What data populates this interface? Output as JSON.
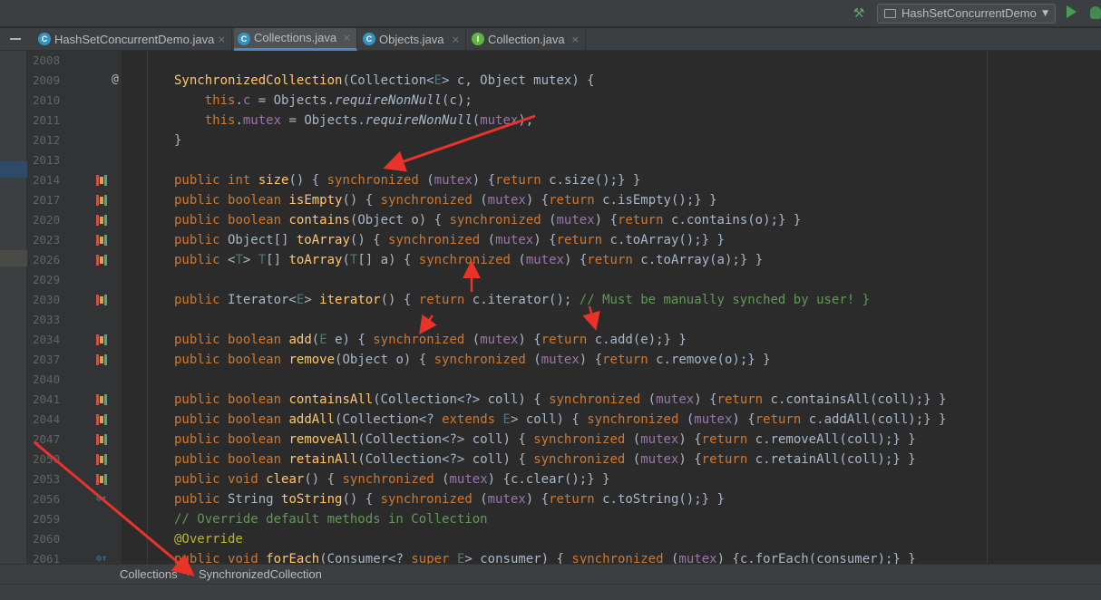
{
  "toolbar": {
    "run_config": "HashSetConcurrentDemo"
  },
  "tabs": [
    {
      "label": "HashSetConcurrentDemo.java",
      "icon": "class-icon",
      "active": false
    },
    {
      "label": "Collections.java",
      "icon": "class-icon",
      "active": true
    },
    {
      "label": "Objects.java",
      "icon": "class-icon",
      "active": false
    },
    {
      "label": "Collection.java",
      "icon": "interface-icon",
      "active": false
    }
  ],
  "close_glyph": "×",
  "breadcrumb": {
    "items": [
      "Collections",
      "SynchronizedCollection"
    ],
    "separator": "›"
  },
  "editor": {
    "line_numbers": [
      "2008",
      "2009",
      "2010",
      "2011",
      "2012",
      "2013",
      "2014",
      "2017",
      "2020",
      "2023",
      "2026",
      "2029",
      "2030",
      "2033",
      "2034",
      "2037",
      "2040",
      "2041",
      "2044",
      "2047",
      "2050",
      "2053",
      "2056",
      "2059",
      "2060",
      "2061"
    ],
    "code": [
      "",
      "SynchronizedCollection(Collection<E> c, Object mutex) {",
      "    this.c = Objects.requireNonNull(c);",
      "    this.mutex = Objects.requireNonNull(mutex);",
      "}",
      "",
      "public int size() { synchronized (mutex) {return c.size();} }",
      "public boolean isEmpty() { synchronized (mutex) {return c.isEmpty();} }",
      "public boolean contains(Object o) { synchronized (mutex) {return c.contains(o);} }",
      "public Object[] toArray() { synchronized (mutex) {return c.toArray();} }",
      "public <T> T[] toArray(T[] a) { synchronized (mutex) {return c.toArray(a);} }",
      "",
      "public Iterator<E> iterator() { return c.iterator(); // Must be manually synched by user! }",
      "",
      "public boolean add(E e) { synchronized (mutex) {return c.add(e);} }",
      "public boolean remove(Object o) { synchronized (mutex) {return c.remove(o);} }",
      "",
      "public boolean containsAll(Collection<?> coll) { synchronized (mutex) {return c.containsAll(coll);} }",
      "public boolean addAll(Collection<? extends E> coll) { synchronized (mutex) {return c.addAll(coll);} }",
      "public boolean removeAll(Collection<?> coll) { synchronized (mutex) {return c.removeAll(coll);} }",
      "public boolean retainAll(Collection<?> coll) { synchronized (mutex) {return c.retainAll(coll);} }",
      "public void clear() { synchronized (mutex) {c.clear();} }",
      "public String toString() { synchronized (mutex) {return c.toString();} }",
      "// Override default methods in Collection",
      "@Override",
      "public void forEach(Consumer<? super E> consumer) { synchronized (mutex) {c.forEach(consumer);} }"
    ]
  },
  "colors": {
    "keyword": "#cc7832",
    "method": "#ffc66d",
    "field": "#9876aa",
    "comment": "#629755",
    "annotation": "#bbb529",
    "arrow": "#e8332a"
  }
}
